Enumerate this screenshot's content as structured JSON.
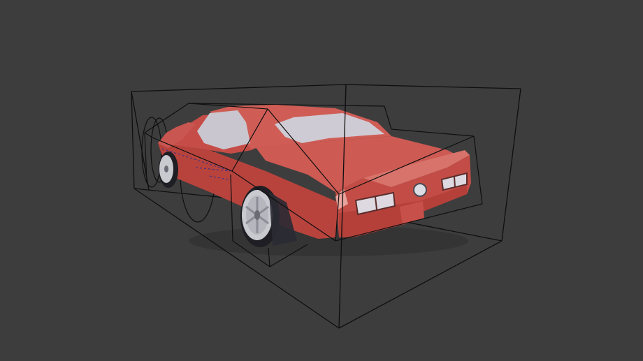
{
  "viewport": {
    "background": "#3d3d3d",
    "shading": "solid"
  },
  "scene": {
    "objects": [
      {
        "name": "car-body",
        "color": "#c8534c",
        "type": "mesh"
      },
      {
        "name": "car-windows",
        "color": "#c9c6cf",
        "type": "mesh"
      },
      {
        "name": "tail-lights",
        "color": "#d6d6de",
        "type": "mesh"
      },
      {
        "name": "wheels",
        "color": "#1e1e24",
        "type": "mesh"
      },
      {
        "name": "rims",
        "color": "#c9c9d0",
        "type": "mesh"
      },
      {
        "name": "bounding-boxes",
        "color": "#0f0f0f",
        "type": "wireframe"
      }
    ]
  }
}
